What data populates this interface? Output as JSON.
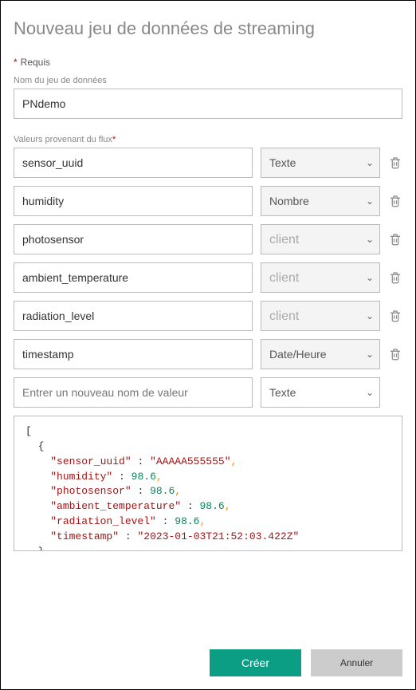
{
  "title": "Nouveau jeu de données de streaming",
  "required_label": "Requis",
  "dataset_name_label": "Nom du jeu de données",
  "dataset_name_value": "PNdemo",
  "flux_label": "Valeurs provenant du flux",
  "type_options": {
    "text": "Texte",
    "number": "Nombre",
    "client": "client",
    "datetime": "Date/Heure"
  },
  "flux_rows": [
    {
      "name": "sensor_uuid",
      "type": "Texte"
    },
    {
      "name": "humidity",
      "type": "Nombre"
    },
    {
      "name": "photosensor",
      "type": "client"
    },
    {
      "name": "ambient_temperature",
      "type": "client"
    },
    {
      "name": "radiation_level",
      "type": "client"
    },
    {
      "name": "timestamp",
      "type": "Date/Heure"
    }
  ],
  "new_row": {
    "placeholder": "Entrer un nouveau nom de valeur",
    "type": "Texte"
  },
  "sample_json": [
    {
      "sensor_uuid": "AAAAA555555",
      "humidity": 98.6,
      "photosensor": 98.6,
      "ambient_temperature": 98.6,
      "radiation_level": 98.6,
      "timestamp": "2023-01-03T21:52:03.422Z"
    }
  ],
  "buttons": {
    "create": "Créer",
    "cancel": "Annuler"
  }
}
